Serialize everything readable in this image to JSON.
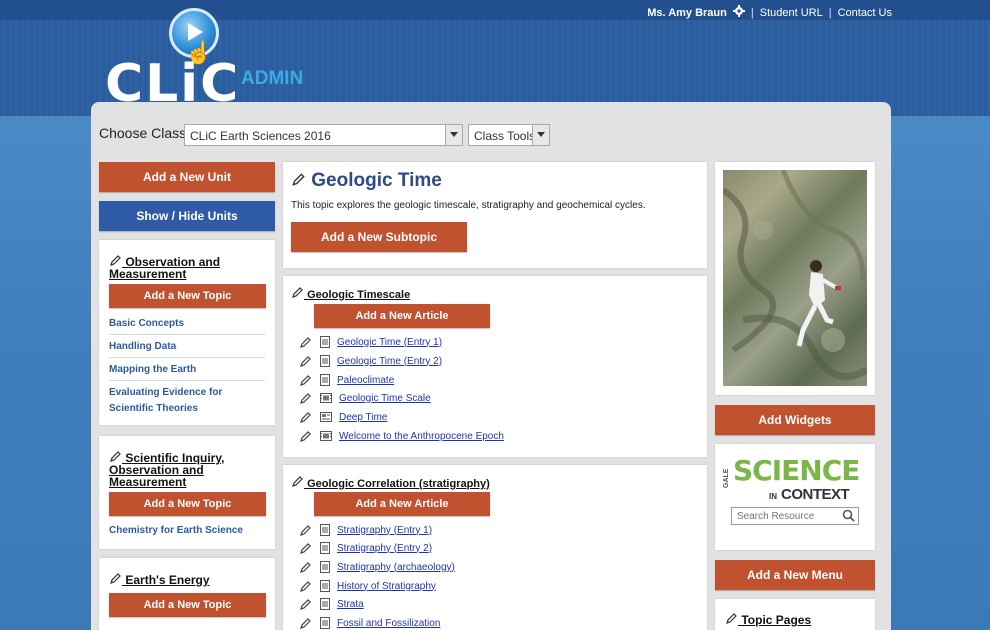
{
  "header": {
    "user_name": "Ms. Amy Braun",
    "separator": "|",
    "student_url": "Student URL",
    "contact_us": "Contact Us",
    "logo_text": "CLiC",
    "logo_sub": "ADMIN"
  },
  "class_bar": {
    "choose_label": "Choose Class",
    "class_value": "CLiC Earth Sciences 2016",
    "tools_value": "Class Tools"
  },
  "sidebar": {
    "add_unit": "Add a New Unit",
    "show_hide": "Show / Hide Units",
    "add_topic": "Add a New Topic",
    "units": [
      {
        "title": "Observation and Measurement",
        "topics": [
          "Basic Concepts",
          "Handling Data",
          "Mapping the Earth",
          "Evaluating Evidence for Scientific Theories"
        ]
      },
      {
        "title": "Scientific Inquiry, Observation and Measurement",
        "topics": [
          "Chemistry for Earth Science"
        ]
      },
      {
        "title": "Earth's Energy",
        "topics": []
      }
    ]
  },
  "topic": {
    "title": "Geologic Time",
    "description": "This topic explores the geologic timescale, stratigraphy and geochemical cycles.",
    "add_subtopic": "Add a New Subtopic"
  },
  "subtopics": [
    {
      "title": "Geologic Timescale",
      "add_article": "Add a New Article",
      "articles": [
        {
          "label": "Geologic Time (Entry 1)",
          "icon": "document-icon"
        },
        {
          "label": "Geologic Time (Entry 2)",
          "icon": "document-icon"
        },
        {
          "label": "Paleoclimate",
          "icon": "document-icon"
        },
        {
          "label": "Geologic Time Scale",
          "icon": "video-icon"
        },
        {
          "label": "Deep Time",
          "icon": "image-icon"
        },
        {
          "label": "Welcome to the Anthropocene Epoch",
          "icon": "video-icon"
        }
      ]
    },
    {
      "title": "Geologic Correlation (stratigraphy)",
      "add_article": "Add a New Article",
      "articles": [
        {
          "label": "Stratigraphy (Entry 1)",
          "icon": "document-icon"
        },
        {
          "label": "Stratigraphy (Entry 2)",
          "icon": "document-icon"
        },
        {
          "label": "Stratigraphy (archaeology)",
          "icon": "document-icon"
        },
        {
          "label": "History of Stratigraphy",
          "icon": "document-icon"
        },
        {
          "label": "Strata",
          "icon": "document-icon"
        },
        {
          "label": "Fossil and Fossilization",
          "icon": "document-icon"
        }
      ]
    }
  ],
  "right": {
    "add_widgets": "Add Widgets",
    "gale_label": "GALE",
    "science_label": "SCIENCE",
    "in_label": "IN",
    "context_label": "CONTEXT",
    "search_placeholder": "Search Resource",
    "add_menu": "Add a New Menu",
    "topic_pages": "Topic Pages"
  },
  "colors": {
    "accent_orange": "#c0522f",
    "accent_blue": "#2e5aa6",
    "title_blue": "#2e4a87",
    "link_blue": "#2233aa"
  }
}
